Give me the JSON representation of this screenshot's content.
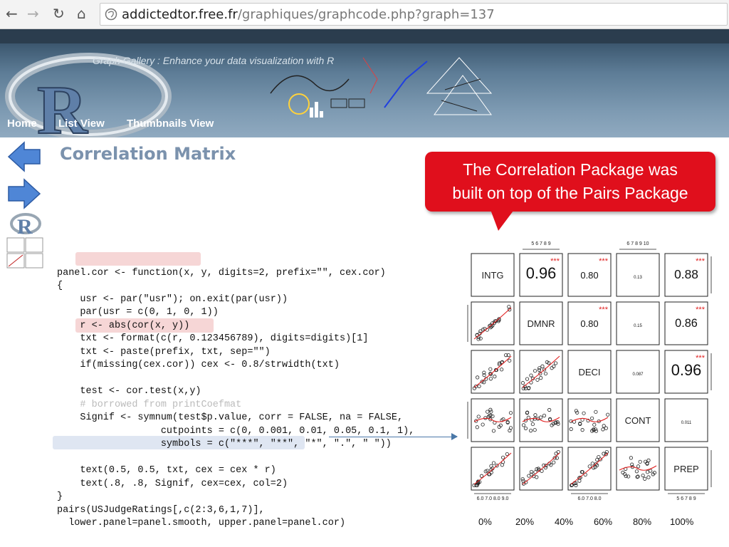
{
  "browser": {
    "url_host": "addictedtor.free.fr",
    "url_path": "/graphiques/graphcode.php?graph=137"
  },
  "banner": {
    "tagline": "Graph Gallery : Enhance your data visualization with R",
    "nav": [
      "Home",
      "List View",
      "Thumbnails View"
    ]
  },
  "page": {
    "title": "Correlation Matrix"
  },
  "code_lines": [
    "panel.cor <- function(x, y, digits=2, prefix=\"\", cex.cor)",
    "{",
    "    usr <- par(\"usr\"); on.exit(par(usr))",
    "    par(usr = c(0, 1, 0, 1))",
    "    r <- abs(cor(x, y))",
    "    txt <- format(c(r, 0.123456789), digits=digits)[1]",
    "    txt <- paste(prefix, txt, sep=\"\")",
    "    if(missing(cex.cor)) cex <- 0.8/strwidth(txt)",
    "",
    "    test <- cor.test(x,y)",
    "    # borrowed from printCoefmat",
    "    Signif <- symnum(test$p.value, corr = FALSE, na = FALSE,",
    "                  cutpoints = c(0, 0.001, 0.01, 0.05, 0.1, 1),",
    "                  symbols = c(\"***\", \"**\", \"*\", \".\", \" \"))",
    "",
    "    text(0.5, 0.5, txt, cex = cex * r)",
    "    text(.8, .8, Signif, cex=cex, col=2)",
    "}",
    "pairs(USJudgeRatings[,c(2:3,6,1,7)],",
    "  lower.panel=panel.smooth, upper.panel=panel.cor)"
  ],
  "callout": {
    "line1": "The Correlation Package was",
    "line2": "built on top of the Pairs Package"
  },
  "chart_data": {
    "type": "scatter",
    "variables": [
      "INTG",
      "DMNR",
      "DECI",
      "CONT",
      "PREP"
    ],
    "correlations": [
      {
        "row": "INTG",
        "col": "DMNR",
        "value": "0.96",
        "signif": "***"
      },
      {
        "row": "INTG",
        "col": "DECI",
        "value": "0.80",
        "signif": "***"
      },
      {
        "row": "INTG",
        "col": "CONT",
        "value": "0.13",
        "signif": ""
      },
      {
        "row": "INTG",
        "col": "PREP",
        "value": "0.88",
        "signif": "***"
      },
      {
        "row": "DMNR",
        "col": "DECI",
        "value": "0.80",
        "signif": "***"
      },
      {
        "row": "DMNR",
        "col": "CONT",
        "value": "0.15",
        "signif": ""
      },
      {
        "row": "DMNR",
        "col": "PREP",
        "value": "0.86",
        "signif": "***"
      },
      {
        "row": "DECI",
        "col": "CONT",
        "value": "0.087",
        "signif": ""
      },
      {
        "row": "DECI",
        "col": "PREP",
        "value": "0.96",
        "signif": "***"
      },
      {
        "row": "CONT",
        "col": "PREP",
        "value": "0.011",
        "signif": ""
      }
    ],
    "top_ticks": [
      "5 6 7 8 9",
      "6 7 8 9 10"
    ],
    "bottom_ticks": [
      "6.0 7.0 8.0 9.0",
      "6.0 7.0 8.0",
      "5 6 7 8 9"
    ],
    "x_percent_labels": [
      "0%",
      "20%",
      "40%",
      "60%",
      "80%",
      "100%"
    ],
    "point_color": "#222222",
    "smooth_color": "#e02020",
    "signif_color": "#e02020"
  },
  "colors": {
    "callout": "#e00f1c",
    "title": "#7b92ad",
    "code_highlight_red": "#f6d6d6",
    "code_highlight_blue": "#dfe6f2"
  }
}
